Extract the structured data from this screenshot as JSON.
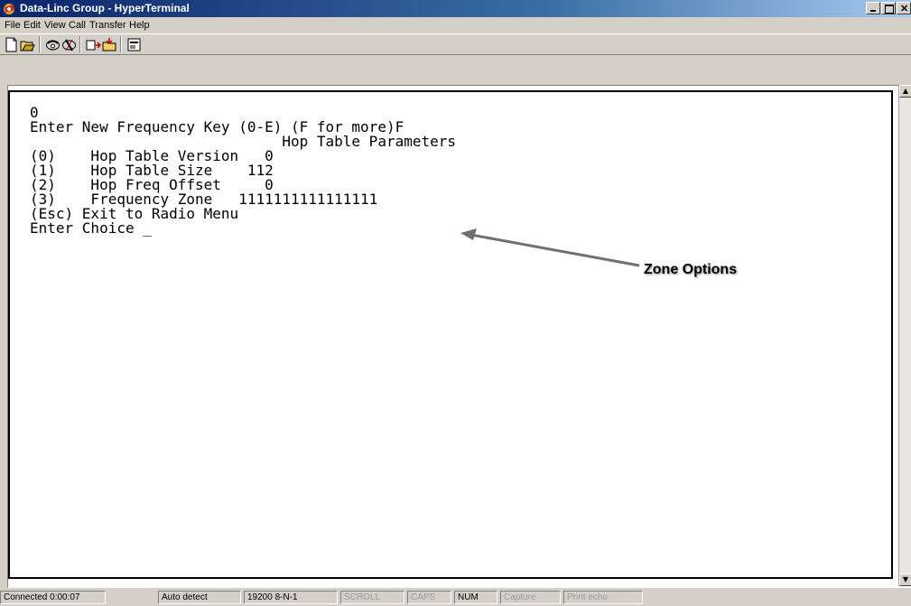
{
  "window": {
    "title": "Data-Linc Group - HyperTerminal",
    "controls": [
      "minimize",
      "maximize",
      "close"
    ]
  },
  "menu": {
    "items": [
      "File",
      "Edit",
      "View",
      "Call",
      "Transfer",
      "Help"
    ]
  },
  "toolbar": {
    "buttons": [
      "new-icon",
      "open-icon",
      "dial-icon",
      "disconnect-icon",
      "send-icon",
      "receive-icon",
      "properties-icon"
    ]
  },
  "terminal": {
    "lines": [
      "0",
      "Enter New Frequency Key (0-E) (F for more)F",
      "                             Hop Table Parameters",
      "(0)    Hop Table Version   0",
      "(1)    Hop Table Size    112",
      "(2)    Hop Freq Offset     0",
      "(3)    Frequency Zone   1111111111111111",
      "(Esc) Exit to Radio Menu",
      "Enter Choice "
    ],
    "cursor": "_"
  },
  "annotation": {
    "label": "Zone Options"
  },
  "status_bar": {
    "connected": "Connected 0:00:07",
    "detect": "Auto detect",
    "settings": "19200 8-N-1",
    "scroll": "SCROLL",
    "caps": "CAPS",
    "num": "NUM",
    "capture": "Capture",
    "print_echo": "Print echo"
  },
  "colors": {
    "title_bar": "#0a246a",
    "window_chrome": "#d4d0c8",
    "terminal_bg": "#ffffff",
    "arrow": "#707070"
  }
}
